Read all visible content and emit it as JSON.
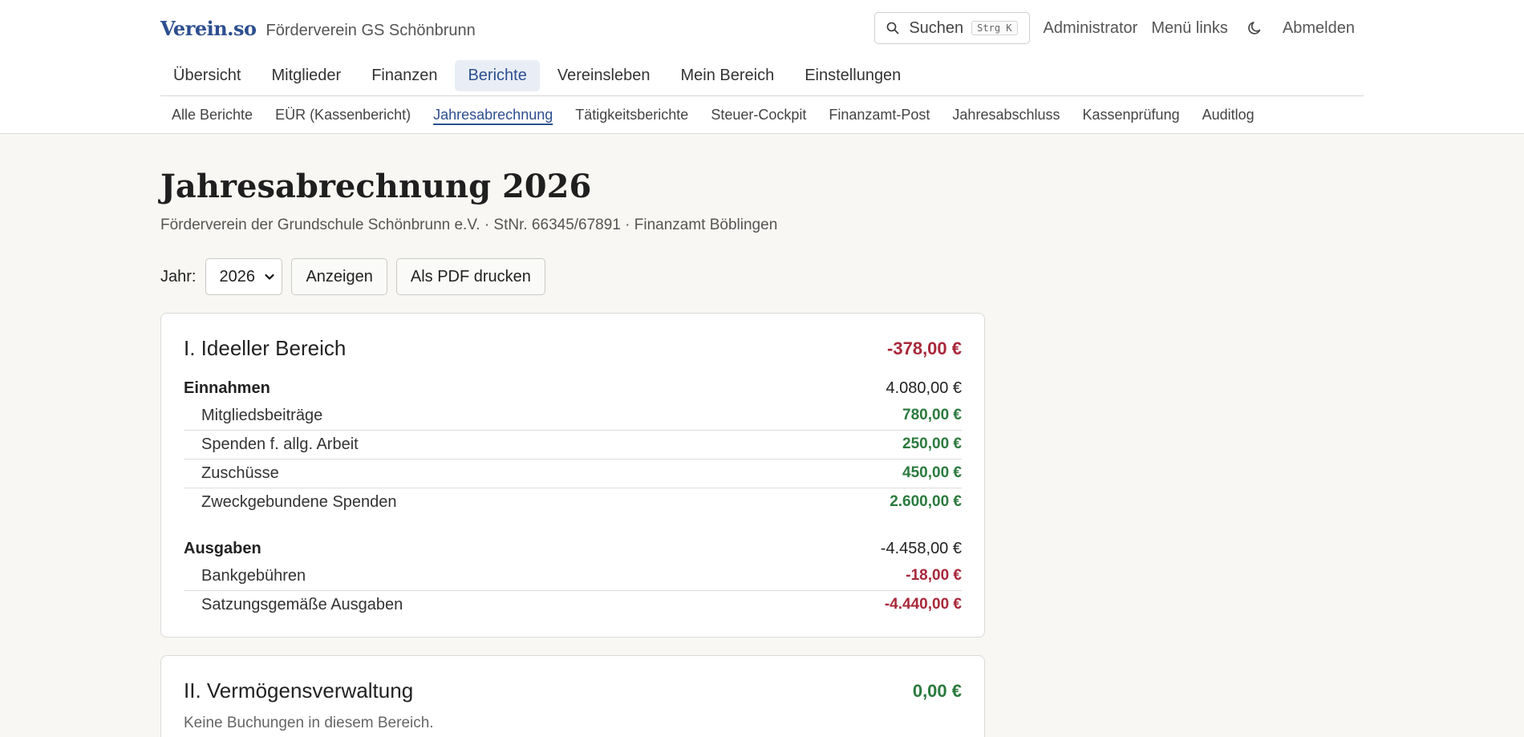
{
  "header": {
    "logo": "Verein.so",
    "org": "Förderverein GS Schönbrunn",
    "search_label": "Suchen",
    "search_shortcut": "Strg K",
    "admin": "Administrator",
    "menu_left": "Menü links",
    "logout": "Abmelden",
    "theme_icon": "moon-icon"
  },
  "main_nav": [
    {
      "label": "Übersicht"
    },
    {
      "label": "Mitglieder"
    },
    {
      "label": "Finanzen"
    },
    {
      "label": "Berichte",
      "active": true
    },
    {
      "label": "Vereinsleben"
    },
    {
      "label": "Mein Bereich"
    },
    {
      "label": "Einstellungen"
    }
  ],
  "sub_nav": [
    {
      "label": "Alle Berichte"
    },
    {
      "label": "EÜR (Kassenbericht)"
    },
    {
      "label": "Jahresabrechnung",
      "active": true
    },
    {
      "label": "Tätigkeitsberichte"
    },
    {
      "label": "Steuer-Cockpit"
    },
    {
      "label": "Finanzamt-Post"
    },
    {
      "label": "Jahresabschluss"
    },
    {
      "label": "Kassenprüfung"
    },
    {
      "label": "Auditlog"
    }
  ],
  "page": {
    "title": "Jahresabrechnung 2026",
    "subtitle": "Förderverein der Grundschule Schönbrunn e.V. · StNr. 66345/67891 · Finanzamt Böblingen"
  },
  "controls": {
    "year_label": "Jahr:",
    "year_value": "2026",
    "show_button": "Anzeigen",
    "pdf_button": "Als PDF drucken"
  },
  "sections": {
    "ideell": {
      "title": "I. Ideeller Bereich",
      "total": "-378,00 €",
      "income_label": "Einnahmen",
      "income_total": "4.080,00 €",
      "income_items": [
        {
          "label": "Mitgliedsbeiträge",
          "amount": "780,00 €"
        },
        {
          "label": "Spenden f. allg. Arbeit",
          "amount": "250,00 €"
        },
        {
          "label": "Zuschüsse",
          "amount": "450,00 €"
        },
        {
          "label": "Zweckgebundene Spenden",
          "amount": "2.600,00 €"
        }
      ],
      "expense_label": "Ausgaben",
      "expense_total": "-4.458,00 €",
      "expense_items": [
        {
          "label": "Bankgebühren",
          "amount": "-18,00 €"
        },
        {
          "label": "Satzungsgemäße Ausgaben",
          "amount": "-4.440,00 €"
        }
      ]
    },
    "vermoegen": {
      "title": "II. Vermögensverwaltung",
      "total": "0,00 €",
      "empty_text": "Keine Buchungen in diesem Bereich."
    }
  },
  "colors": {
    "accent": "#2d4f8f",
    "negative": "#a8283a",
    "positive": "#2b7a3e"
  }
}
